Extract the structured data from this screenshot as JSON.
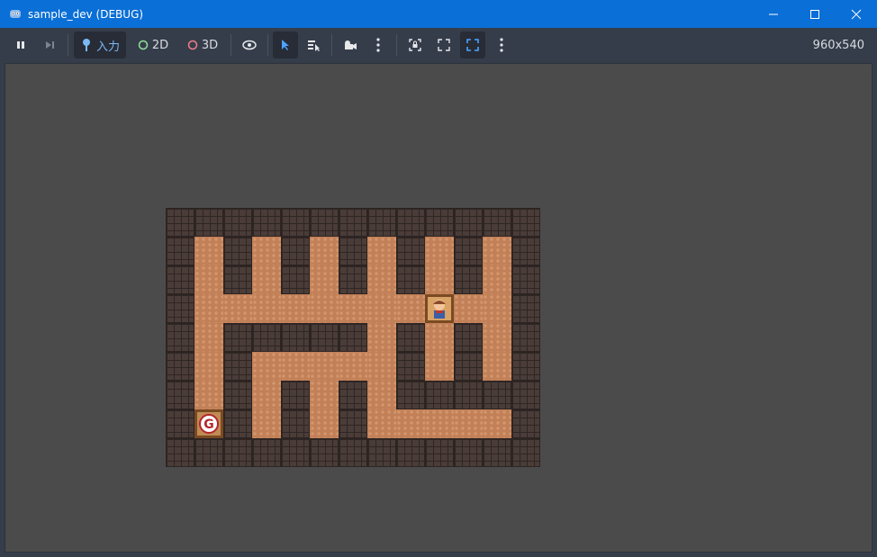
{
  "window": {
    "title": "sample_dev (DEBUG)",
    "minimize": "minimize",
    "maximize": "maximize",
    "close": "close"
  },
  "toolbar": {
    "input_label": "入力",
    "mode_2d": "2D",
    "mode_3d": "3D",
    "resolution": "960x540"
  },
  "colors": {
    "titlebar": "#0a6fd6",
    "toolbar": "#363d4a",
    "viewport_bg": "#4b4b4b",
    "accent": "#4da3ff",
    "wall": "#4a3c38",
    "floor": "#c28058"
  },
  "maze": {
    "rows": [
      "#############",
      "#.#.#.#.#.#.#",
      "#.#.#.#.#.#.#",
      "#..............#",
      "#.#####.#.#.#",
      "#.#.....#.#.#",
      "#.#.#.#.#####",
      "#.#.#.#.....#",
      "#############"
    ],
    "player_symbol": "player",
    "goal_label": "G"
  }
}
